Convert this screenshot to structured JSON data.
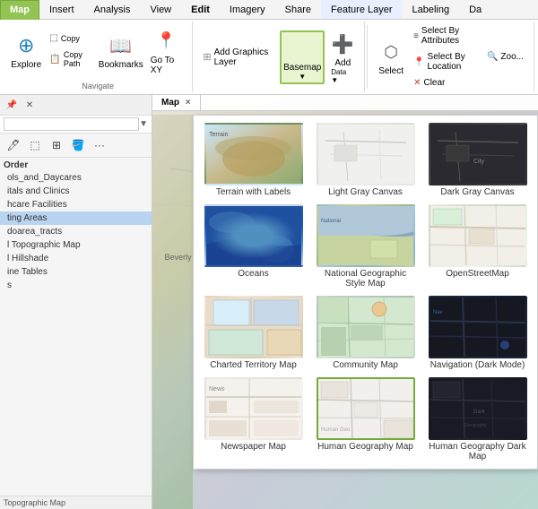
{
  "tabs": {
    "active": "Map",
    "items": [
      "Map",
      "Insert",
      "Analysis",
      "View",
      "Edit",
      "Imagery",
      "Share",
      "Feature Layer",
      "Labeling",
      "Da"
    ]
  },
  "ribbon": {
    "groups": {
      "navigate": {
        "label": "Navigate",
        "buttons": [
          "Explore",
          "Bookmarks",
          "Go To XY"
        ]
      },
      "layer": {
        "add_graphics": "Add Graphics Layer"
      },
      "basemap": {
        "label": "Basemap",
        "add_data": "Add Data"
      },
      "select": {
        "buttons": [
          "Select",
          "Select By Attributes",
          "Select By Location",
          "Clear"
        ]
      }
    }
  },
  "left_panel": {
    "title": "",
    "search_placeholder": "",
    "layers": [
      {
        "id": 1,
        "name": "ols_and_Daycares",
        "selected": false
      },
      {
        "id": 2,
        "name": "itals and Clinics",
        "selected": false
      },
      {
        "id": 3,
        "name": "hcare Facilities",
        "selected": false
      },
      {
        "id": 4,
        "name": "ting Areas",
        "selected": true
      },
      {
        "id": 5,
        "name": "doarea_tracts",
        "selected": false
      },
      {
        "id": 6,
        "name": "l Topographic Map",
        "selected": false
      },
      {
        "id": 7,
        "name": "l Hillshade",
        "selected": false
      },
      {
        "id": 8,
        "name": "ine Tables",
        "selected": false
      },
      {
        "id": 9,
        "name": "s",
        "selected": false
      }
    ]
  },
  "map_tabs": [
    {
      "label": "Map",
      "active": true
    },
    {
      "label": "×",
      "active": false
    }
  ],
  "basemap_panel": {
    "items": [
      {
        "id": "terrain",
        "name": "Terrain with Labels",
        "thumb_class": "thumb-terrain",
        "selected": false
      },
      {
        "id": "lightgray",
        "name": "Light Gray Canvas",
        "thumb_class": "thumb-lightgray",
        "selected": false
      },
      {
        "id": "darkgray",
        "name": "Dark Gray Canvas",
        "thumb_class": "thumb-darkgray",
        "selected": false
      },
      {
        "id": "oceans",
        "name": "Oceans",
        "thumb_class": "thumb-oceans",
        "selected": false
      },
      {
        "id": "natgeo",
        "name": "National Geographic Style Map",
        "thumb_class": "thumb-natgeo",
        "selected": false
      },
      {
        "id": "openstreet",
        "name": "OpenStreetMap",
        "thumb_class": "thumb-openstreet",
        "selected": false
      },
      {
        "id": "charted",
        "name": "Charted Territory Map",
        "thumb_class": "thumb-charted",
        "selected": false
      },
      {
        "id": "community",
        "name": "Community Map",
        "thumb_class": "thumb-community",
        "selected": false
      },
      {
        "id": "navdark",
        "name": "Navigation (Dark Mode)",
        "thumb_class": "thumb-navdark",
        "selected": false
      },
      {
        "id": "newspaper",
        "name": "Newspaper Map",
        "thumb_class": "thumb-newspaper",
        "selected": false
      },
      {
        "id": "humangeo",
        "name": "Human Geography Map",
        "thumb_class": "thumb-humangeo",
        "selected": true
      },
      {
        "id": "humangeo-dark",
        "name": "Human Geography Dark Map",
        "thumb_class": "thumb-humangeo-dark",
        "selected": false
      }
    ]
  },
  "map": {
    "location_label": "Beverly Hills"
  },
  "bottom_bar": {
    "topographic_map": "Topographic Map"
  }
}
